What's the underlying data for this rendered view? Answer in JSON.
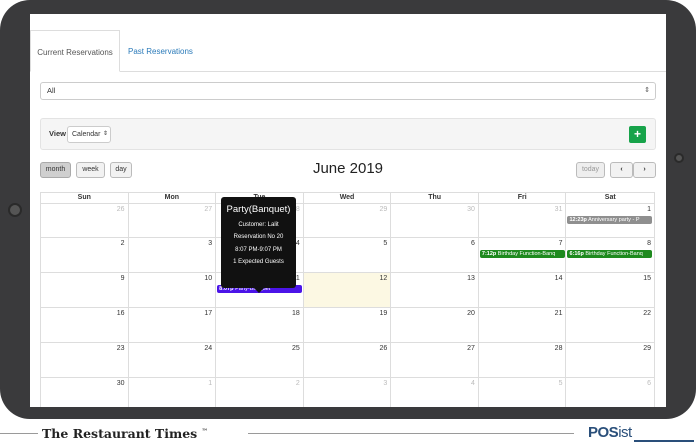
{
  "tabs": {
    "current": "Current Reservations",
    "past": "Past Reservations"
  },
  "filter": {
    "selected": "All",
    "arrows": "⇕"
  },
  "view": {
    "label": "View",
    "selected": "Calendar",
    "arrows": "⇕",
    "add_icon": "+"
  },
  "toolbar": {
    "month": "month",
    "week": "week",
    "day": "day",
    "today": "today",
    "prev": "‹",
    "next": "›"
  },
  "calendar": {
    "title": "June 2019",
    "dow": [
      "Sun",
      "Mon",
      "Tue",
      "Wed",
      "Thu",
      "Fri",
      "Sat"
    ],
    "weeks": [
      [
        "26",
        "27",
        "28",
        "29",
        "30",
        "31",
        "1"
      ],
      [
        "2",
        "3",
        "4",
        "5",
        "6",
        "7",
        "8"
      ],
      [
        "9",
        "10",
        "11",
        "12",
        "13",
        "14",
        "15"
      ],
      [
        "16",
        "17",
        "18",
        "19",
        "20",
        "21",
        "22"
      ],
      [
        "23",
        "24",
        "25",
        "26",
        "27",
        "28",
        "29"
      ],
      [
        "30",
        "1",
        "2",
        "3",
        "4",
        "5",
        "6"
      ]
    ],
    "events": {
      "anniversary": {
        "time": "12:23p",
        "text": "Anniversary party - P"
      },
      "birthday1": {
        "time": "7:12p",
        "text": "Birthday Function-Banq"
      },
      "birthday2": {
        "time": "6:16p",
        "text": "Birthday Function-Banq"
      },
      "party": {
        "time": "8:07p",
        "text": "Party-Banquet"
      }
    }
  },
  "tooltip": {
    "title": "Party(Banquet)",
    "customer": "Customer: Lalit",
    "reservation": "Reservation No 20",
    "time": "8:07 PM-9:07 PM",
    "guests": "1 Expected Guests"
  },
  "footer": {
    "brand": "The Restaurant Times",
    "tm": "™",
    "logo_pos": "POS",
    "logo_ist": "ist"
  },
  "colors": {
    "frame": "#3a3a3c",
    "accent": "#2a7ab9",
    "green": "#1e8a1e",
    "purple": "#4b14e8",
    "today": "#fcf8e3"
  }
}
